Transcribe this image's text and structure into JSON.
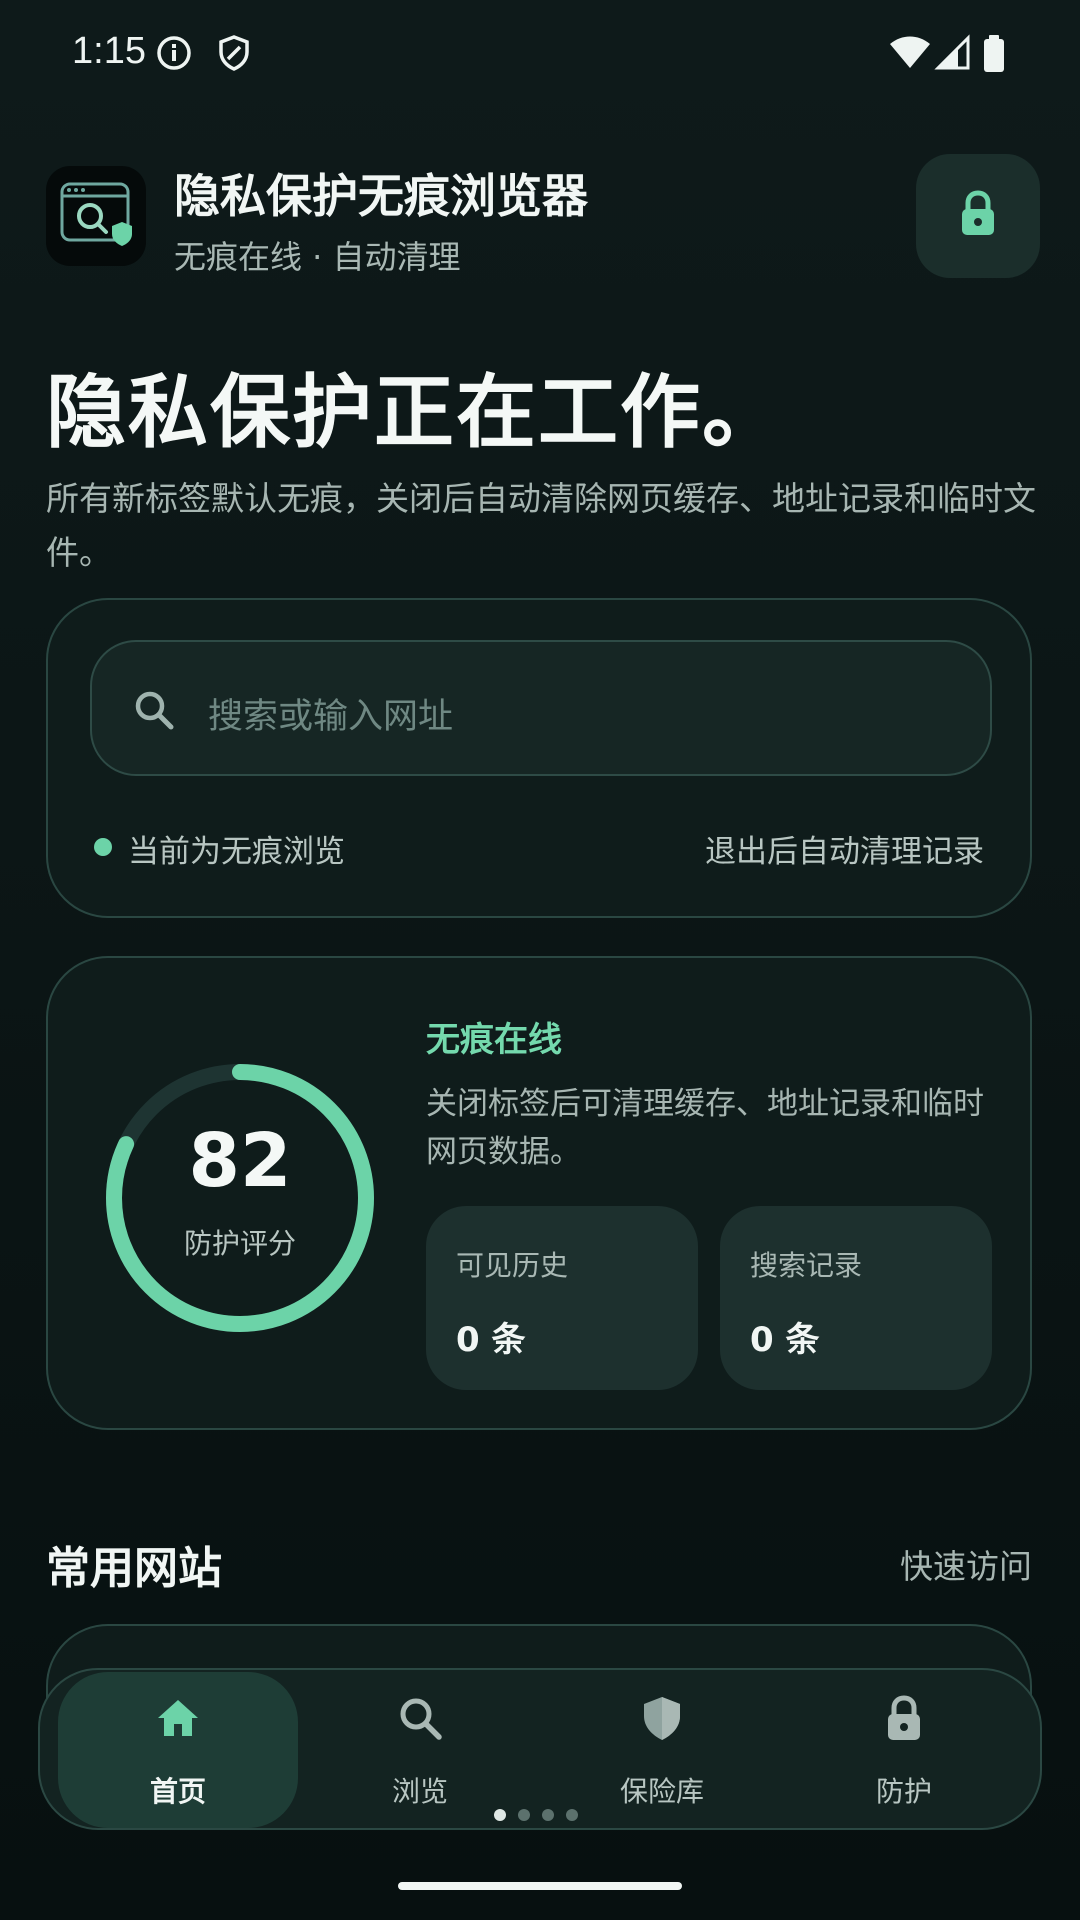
{
  "status_bar": {
    "time": "1:15",
    "left_icons": [
      "info-icon",
      "shield-icon"
    ],
    "right_icons": [
      "wifi-icon",
      "signal-icon",
      "battery-icon"
    ]
  },
  "header": {
    "app_name": "隐私保护无痕浏览器",
    "subtitle": "无痕在线 · 自动清理",
    "logo_icon": "browser-search-shield-icon",
    "lock_icon": "lock-icon"
  },
  "hero": {
    "title": "隐私保护正在工作。",
    "description": "所有新标签默认无痕，关闭后自动清除网页缓存、地址记录和临时文件。"
  },
  "search": {
    "placeholder": "搜索或输入网址",
    "status_left": "当前为无痕浏览",
    "status_right": "退出后自动清理记录"
  },
  "protection": {
    "score": "82",
    "score_fraction": 0.82,
    "score_label": "防护评分",
    "status_title": "无痕在线",
    "status_desc": "关闭标签后可清理缓存、地址记录和临时网页数据。",
    "stats": [
      {
        "label": "可见历史",
        "value": "0 条"
      },
      {
        "label": "搜索记录",
        "value": "0 条"
      }
    ]
  },
  "sites_section": {
    "title": "常用网站",
    "action": "快速访问"
  },
  "bottom_nav": {
    "items": [
      {
        "label": "首页",
        "icon": "home-icon",
        "active": true
      },
      {
        "label": "浏览",
        "icon": "search-icon",
        "active": false
      },
      {
        "label": "保险库",
        "icon": "shield-icon",
        "active": false
      },
      {
        "label": "防护",
        "icon": "lock-icon",
        "active": false
      }
    ],
    "page_indicator": {
      "count": 4,
      "current": 1
    }
  },
  "colors": {
    "accent": "#6cd3a8",
    "background": "#0c1616",
    "card": "#0f1c1b",
    "card_border": "#2a4742"
  }
}
